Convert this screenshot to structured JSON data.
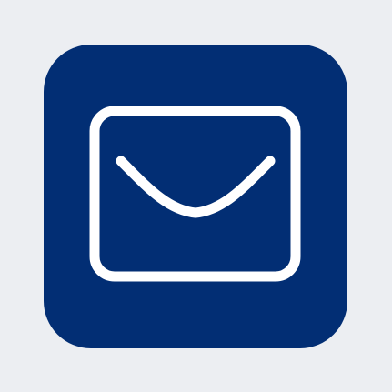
{
  "icon": {
    "name": "mail-icon",
    "background_color": "#022e74",
    "stroke_color": "#ffffff",
    "page_background": "#eceef2"
  }
}
